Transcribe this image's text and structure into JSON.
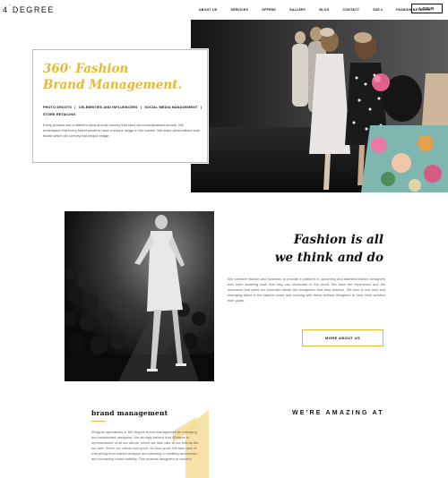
{
  "header": {
    "logo_number": "4",
    "logo_degree": "°",
    "logo_text": "DEGREE",
    "nav": [
      "ABOUT US",
      "SERVICES",
      "OFFERS",
      "GALLERY",
      "BLOG",
      "CONTACT",
      "SZE £",
      "FASHION NETWORK"
    ],
    "login_label": "LOGIN"
  },
  "hero": {
    "title_number": "360",
    "title_degree": "°",
    "title_line1_rest": "Fashion",
    "title_line2": "Brand Management.",
    "tags": [
      "PHOTO SHOOTS",
      "CELEBRITIES AND INFLUENCERS",
      "SOCIAL MEDIA MANAGEMENT",
      "STORE RETAILING"
    ],
    "tag_separator": "|",
    "description": "Every product has a different story and we convey that story via conceptualized shoots. We understand that every brand wants to have a unique image in the market. We make personalized look books which will convey that unique image."
  },
  "section2": {
    "heading_line1": "Fashion is all",
    "heading_line2": "we think and do",
    "body": "We combine fashion and business to provide a platform to upcoming and talented fashion designers who have amazing work that they can showcase to the world. We have the experience and the resources that gives our potential clients the recognition that they deserve. We love to see new and emerging talent in the fashion world and working with these brilliant designers to help them achieve their goals.",
    "button_label": "MORE ABOUT US"
  },
  "section3": {
    "brand_heading": "brand management",
    "brand_body": "4Degree specializes in 360 degree brand management for emerging and established designers. We strongly believe that 4Degree is representative of all our clients, hence we take care of our brands like our own. When our clients look good, we look good. We take care of everything from market analysis and planning to creating awareness and increasing brand visibility. This enables designers to concent",
    "amazing_heading": "WE'RE AMAZING AT"
  },
  "colors": {
    "accent": "#e7b933",
    "text_dark": "#111111",
    "text_muted": "#666666"
  },
  "icons": {
    "hero_image": "runway-models-photo",
    "section_image": "runway-catwalk-bw-photo",
    "decor": "large-numeral-one-graphic"
  }
}
